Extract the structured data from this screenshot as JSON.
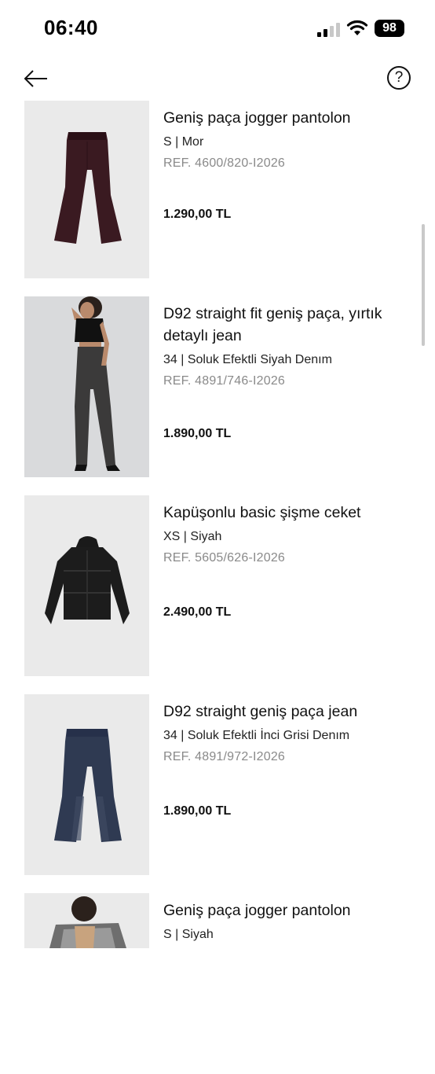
{
  "status_bar": {
    "time": "06:40",
    "battery": "98",
    "icons": [
      "signal-icon",
      "wifi-icon",
      "battery-icon"
    ]
  },
  "header": {
    "back_icon": "arrow-left-icon",
    "help_label": "?"
  },
  "products": [
    {
      "name": "Geniş paça jogger pantolon",
      "variant": "S | Mor",
      "ref": "REF. 4600/820-I2026",
      "price": "1.290,00 TL",
      "image": "burgundy-jogger-pants"
    },
    {
      "name": "D92 straight fit geniş paça, yırtık detaylı jean",
      "variant": "34 | Soluk Efektli Siyah Denım",
      "ref": "REF. 4891/746-I2026",
      "price": "1.890,00 TL",
      "image": "model-black-jeans"
    },
    {
      "name": "Kapüşonlu basic şişme ceket",
      "variant": "XS | Siyah",
      "ref": "REF. 5605/626-I2026",
      "price": "2.490,00 TL",
      "image": "black-puffer-jacket"
    },
    {
      "name": "D92 straight geniş paça jean",
      "variant": "34 | Soluk Efektli İnci Grisi Denım",
      "ref": "REF. 4891/972-I2026",
      "price": "1.890,00 TL",
      "image": "blue-jeans"
    },
    {
      "name": "Geniş paça jogger pantolon",
      "variant": "S | Siyah",
      "ref": "",
      "price": "",
      "image": "model-scarf"
    }
  ]
}
